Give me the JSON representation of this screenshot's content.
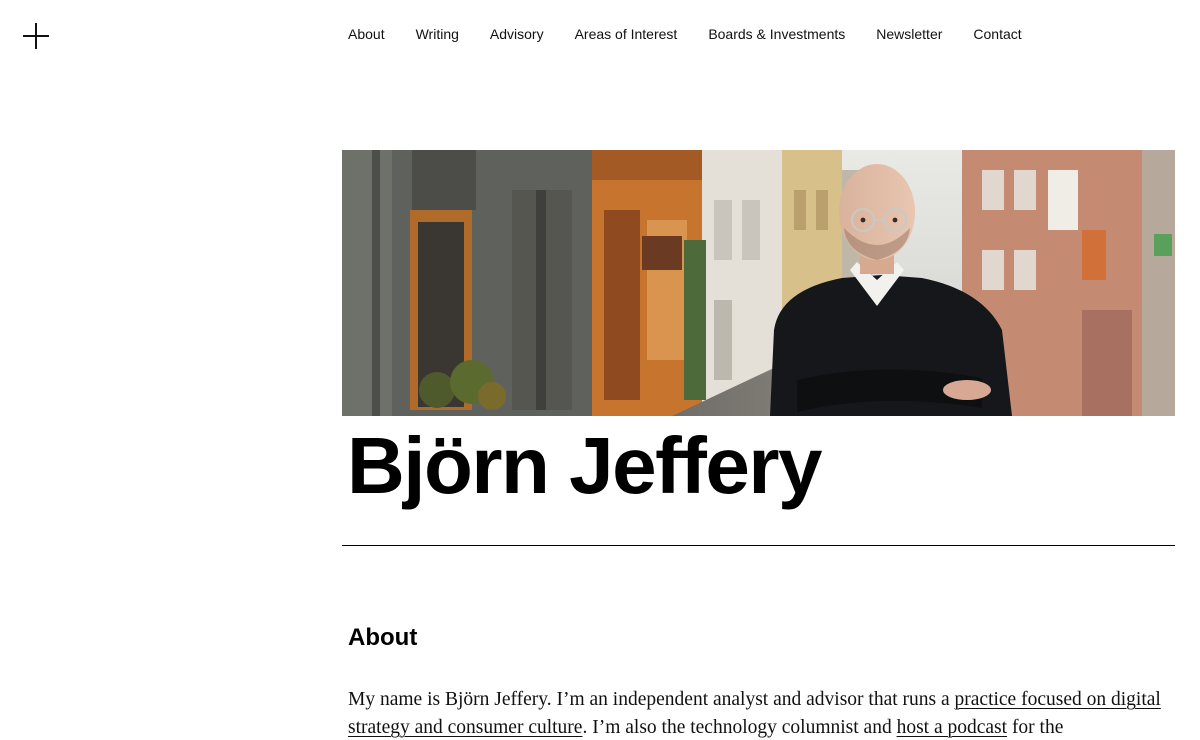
{
  "nav": {
    "items": [
      {
        "label": "About"
      },
      {
        "label": "Writing"
      },
      {
        "label": "Advisory"
      },
      {
        "label": "Areas of Interest"
      },
      {
        "label": "Boards & Investments"
      },
      {
        "label": "Newsletter"
      },
      {
        "label": "Contact"
      }
    ]
  },
  "hero": {
    "name": "Björn Jeffery"
  },
  "about": {
    "heading": "About",
    "p1": "My name is Björn Jeffery. I’m an independent analyst and advisor that runs a ",
    "link1": "practice focused on digital strategy and consumer culture",
    "p2": ". I’m also the technology columnist and ",
    "link2": "host a podcast",
    "p3": " for the"
  },
  "colors": {
    "text": "#000000",
    "background": "#ffffff"
  },
  "icons": {
    "menu": "plus-icon"
  }
}
